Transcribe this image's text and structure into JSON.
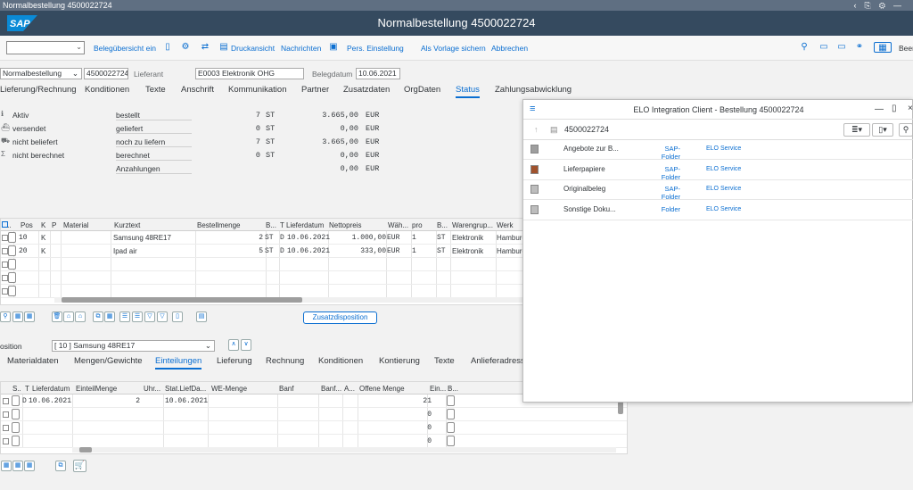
{
  "window": {
    "title": "Normalbestellung 4500022724",
    "controls": [
      "‹",
      "⎘",
      "⚙",
      "—"
    ]
  },
  "shell": {
    "logo": "SAP",
    "title": "Normalbestellung 4500022724"
  },
  "toolbar": {
    "items": [
      "Belegübersicht ein",
      "Druckansicht",
      "Nachrichten",
      "Pers. Einstellung",
      "Als Vorlage sichern",
      "Abbrechen"
    ],
    "more": "Beer"
  },
  "header": {
    "doc_type": "Normalbestellung",
    "po_number": "4500022724",
    "vendor_label": "Lieferant",
    "vendor": "E0003 Elektronik OHG",
    "date_label": "Belegdatum",
    "date": "10.06.2021"
  },
  "header_tabs": {
    "items": [
      "Lieferung/Rechnung",
      "Konditionen",
      "Texte",
      "Anschrift",
      "Kommunikation",
      "Partner",
      "Zusatzdaten",
      "OrgDaten",
      "Status",
      "Zahlungsabwicklung"
    ],
    "active": "Status"
  },
  "status": {
    "rows": [
      {
        "icon": "info-icon",
        "label": "Aktiv",
        "value": "bestellt",
        "qty": "7",
        "unit": "ST",
        "amount": "3.665,00",
        "currency": "EUR"
      },
      {
        "icon": "ship-icon",
        "label": "versendet",
        "value": "geliefert",
        "qty": "0",
        "unit": "ST",
        "amount": "0,00",
        "currency": "EUR"
      },
      {
        "icon": "truck-icon",
        "label": "nicht beliefert",
        "value": "noch zu liefern",
        "qty": "7",
        "unit": "ST",
        "amount": "3.665,00",
        "currency": "EUR"
      },
      {
        "icon": "sigma-icon",
        "label": "nicht berechnet",
        "value": "berechnet",
        "qty": "0",
        "unit": "ST",
        "amount": "0,00",
        "currency": "EUR"
      },
      {
        "icon": "",
        "label": "",
        "value": "Anzahlungen",
        "qty": "",
        "unit": "",
        "amount": "0,00",
        "currency": "EUR"
      }
    ]
  },
  "items": {
    "columns": [
      "S..",
      "Pos",
      "K",
      "P",
      "Material",
      "Kurztext",
      "Bestellmenge",
      "B...",
      "T",
      "Lieferdatum",
      "Nettopreis",
      "Wäh...",
      "pro",
      "B...",
      "Warengrup...",
      "Werk"
    ],
    "rows": [
      {
        "pos": "10",
        "k": "K",
        "text": "Samsung 48RE17",
        "qty": "2",
        "unit": "ST",
        "t": "D",
        "date": "10.06.2021",
        "price": "1.000,00",
        "cur": "EUR",
        "per": "1",
        "bu": "ST",
        "group": "Elektronik",
        "plant": "Hamburg"
      },
      {
        "pos": "20",
        "k": "K",
        "text": "Ipad air",
        "qty": "5",
        "unit": "ST",
        "t": "D",
        "date": "10.06.2021",
        "price": "333,00",
        "cur": "EUR",
        "per": "1",
        "bu": "ST",
        "group": "Elektronik",
        "plant": "Hamburg"
      }
    ],
    "zusatz_button": "Zusatzdisposition"
  },
  "position": {
    "label": "osition",
    "value": "[ 10 ] Samsung 48RE17"
  },
  "item_tabs": {
    "items": [
      "Materialdaten",
      "Mengen/Gewichte",
      "Einteilungen",
      "Lieferung",
      "Rechnung",
      "Konditionen",
      "Kontierung",
      "Texte",
      "Anlieferadresse"
    ],
    "active": "Einteilungen"
  },
  "schedule": {
    "columns": [
      "S..",
      "T",
      "Lieferdatum",
      "EinteilMenge",
      "Uhr...",
      "Stat.LiefDa...",
      "WE-Menge",
      "Banf",
      "Banf...",
      "A...",
      "Offene Menge",
      "Ein...",
      "B..."
    ],
    "rows": [
      {
        "t": "D",
        "date": "10.06.2021",
        "qty": "2",
        "stat_date": "10.06.2021",
        "open": "21"
      },
      {
        "t": "",
        "date": "",
        "qty": "",
        "stat_date": "",
        "open": "0"
      },
      {
        "t": "",
        "date": "",
        "qty": "",
        "stat_date": "",
        "open": "0"
      },
      {
        "t": "",
        "date": "",
        "qty": "",
        "stat_date": "",
        "open": "0"
      }
    ]
  },
  "elo": {
    "title": "ELO Integration Client - Bestellung 4500022724",
    "folder": "4500022724",
    "rows": [
      {
        "name": "Angebote zur B...",
        "f1": "SAP-Folder",
        "f2": "ELO Service",
        "color": "#9e9e9e"
      },
      {
        "name": "Lieferpapiere",
        "f1": "SAP-Folder",
        "f2": "ELO Service",
        "color": "#a0522d"
      },
      {
        "name": "Originalbeleg",
        "f1": "SAP-Folder",
        "f2": "ELO Service",
        "color": "#bdbdbd"
      },
      {
        "name": "Sonstige Doku...",
        "f1": "Folder",
        "f2": "ELO Service",
        "color": "#bdbdbd"
      }
    ]
  }
}
